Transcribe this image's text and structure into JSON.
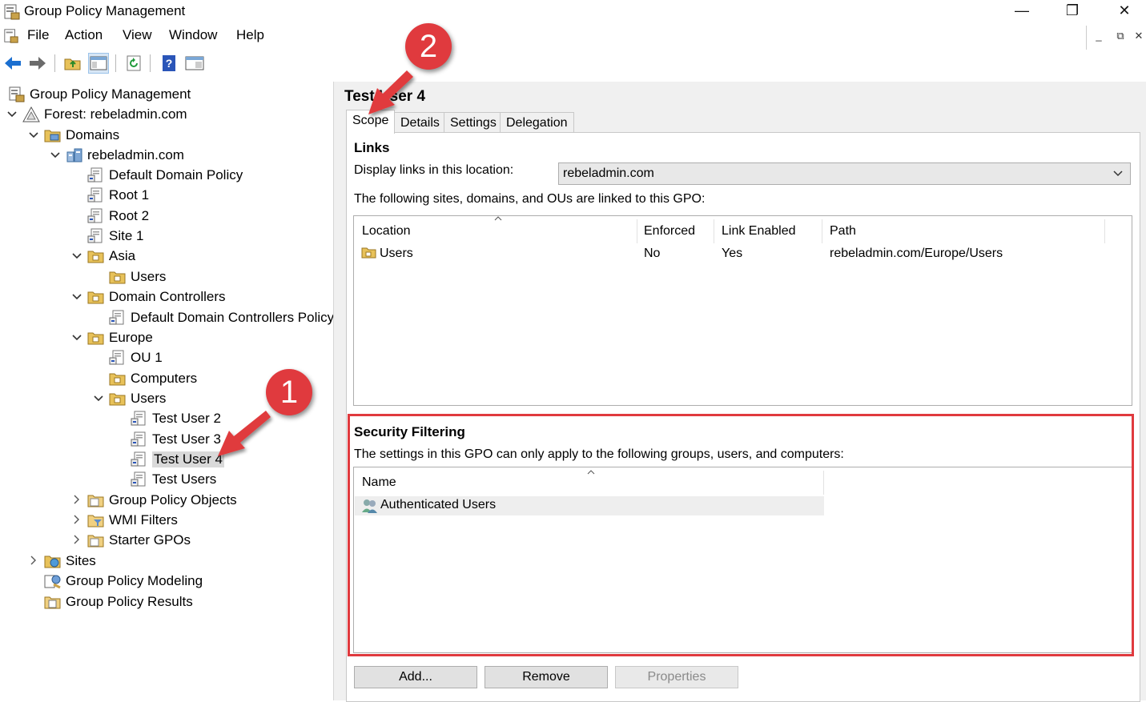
{
  "window": {
    "title": "Group Policy Management",
    "minimize": "—",
    "restore": "❐",
    "close": "✕"
  },
  "menubar": {
    "items": [
      "File",
      "Action",
      "View",
      "Window",
      "Help"
    ],
    "mdi_min": "_",
    "mdi_restore": "⧉",
    "mdi_close": "✕"
  },
  "toolbar": {
    "back_icon": "back-arrow-icon",
    "forward_icon": "forward-arrow-icon"
  },
  "tree": {
    "root": "Group Policy Management",
    "forest": "Forest: rebeladmin.com",
    "domains": "Domains",
    "domain": "rebeladmin.com",
    "default_domain_policy": "Default Domain Policy",
    "root1": "Root 1",
    "root2": "Root 2",
    "site1": "Site 1",
    "asia": "Asia",
    "asia_users": "Users",
    "domain_controllers": "Domain Controllers",
    "default_dc_policy": "Default Domain Controllers Policy",
    "europe": "Europe",
    "ou1": "OU 1",
    "computers": "Computers",
    "europe_users": "Users",
    "test_user2": "Test User 2",
    "test_user3": "Test User 3",
    "test_user4": "Test User 4",
    "test_users": "Test Users",
    "gpo_objects": "Group Policy Objects",
    "wmi_filters": "WMI Filters",
    "starter_gpos": "Starter GPOs",
    "sites": "Sites",
    "gp_modeling": "Group Policy Modeling",
    "gp_results": "Group Policy Results"
  },
  "detail": {
    "title": "Test User 4",
    "tabs": [
      "Scope",
      "Details",
      "Settings",
      "Delegation"
    ],
    "links_heading": "Links",
    "display_links_label": "Display links in this location:",
    "location_value": "rebeladmin.com",
    "linked_text": "The following sites, domains, and OUs are linked to this GPO:",
    "links_columns": [
      "Location",
      "Enforced",
      "Link Enabled",
      "Path"
    ],
    "links_rows": [
      {
        "location": "Users",
        "enforced": "No",
        "link_enabled": "Yes",
        "path": "rebeladmin.com/Europe/Users"
      }
    ],
    "security_heading": "Security Filtering",
    "security_text": "The settings in this GPO can only apply to the following groups, users, and computers:",
    "security_columns": [
      "Name"
    ],
    "security_rows": [
      "Authenticated Users"
    ],
    "buttons": {
      "add": "Add...",
      "remove": "Remove",
      "properties": "Properties"
    }
  },
  "annotations": {
    "badge1": "1",
    "badge2": "2",
    "highlight_color": "#e03a3e"
  },
  "colors": {
    "accent_red": "#e03a3e",
    "selection": "#d9d9d9",
    "chrome": "#f0f0f0"
  }
}
